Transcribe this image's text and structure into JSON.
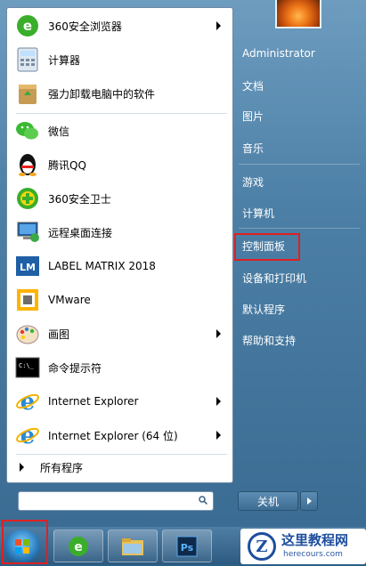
{
  "programs": [
    {
      "label": "360安全浏览器",
      "icon": "360-browser-icon",
      "arrow": true
    },
    {
      "label": "计算器",
      "icon": "calculator-icon",
      "arrow": false
    },
    {
      "label": "强力卸载电脑中的软件",
      "icon": "uninstall-icon",
      "arrow": false
    },
    {
      "label": "微信",
      "icon": "wechat-icon",
      "arrow": false
    },
    {
      "label": "腾讯QQ",
      "icon": "qq-icon",
      "arrow": false
    },
    {
      "label": "360安全卫士",
      "icon": "360-safeguard-icon",
      "arrow": false
    },
    {
      "label": "远程桌面连接",
      "icon": "remote-desktop-icon",
      "arrow": false
    },
    {
      "label": "LABEL MATRIX 2018",
      "icon": "label-matrix-icon",
      "arrow": false
    },
    {
      "label": "VMware",
      "icon": "vmware-icon",
      "arrow": false
    },
    {
      "label": "画图",
      "icon": "paint-icon",
      "arrow": true
    },
    {
      "label": "命令提示符",
      "icon": "cmd-icon",
      "arrow": false
    },
    {
      "label": "Internet Explorer",
      "icon": "ie-icon",
      "arrow": true
    },
    {
      "label": "Internet Explorer (64 位)",
      "icon": "ie-icon",
      "arrow": true
    }
  ],
  "all_programs": "所有程序",
  "search_placeholder": "",
  "right": {
    "user": "Administrator",
    "documents": "文档",
    "pictures": "图片",
    "music": "音乐",
    "games": "游戏",
    "computer": "计算机",
    "control_panel": "控制面板",
    "devices": "设备和打印机",
    "default_programs": "默认程序",
    "help": "帮助和支持"
  },
  "shutdown": "关机",
  "watermark": {
    "title": "这里教程网",
    "url": "herecours.com",
    "logo": "Z"
  },
  "colors": {
    "highlight": "#e02020",
    "menu_bg": "#4c7fa6",
    "taskbar": "#2d5a80"
  }
}
